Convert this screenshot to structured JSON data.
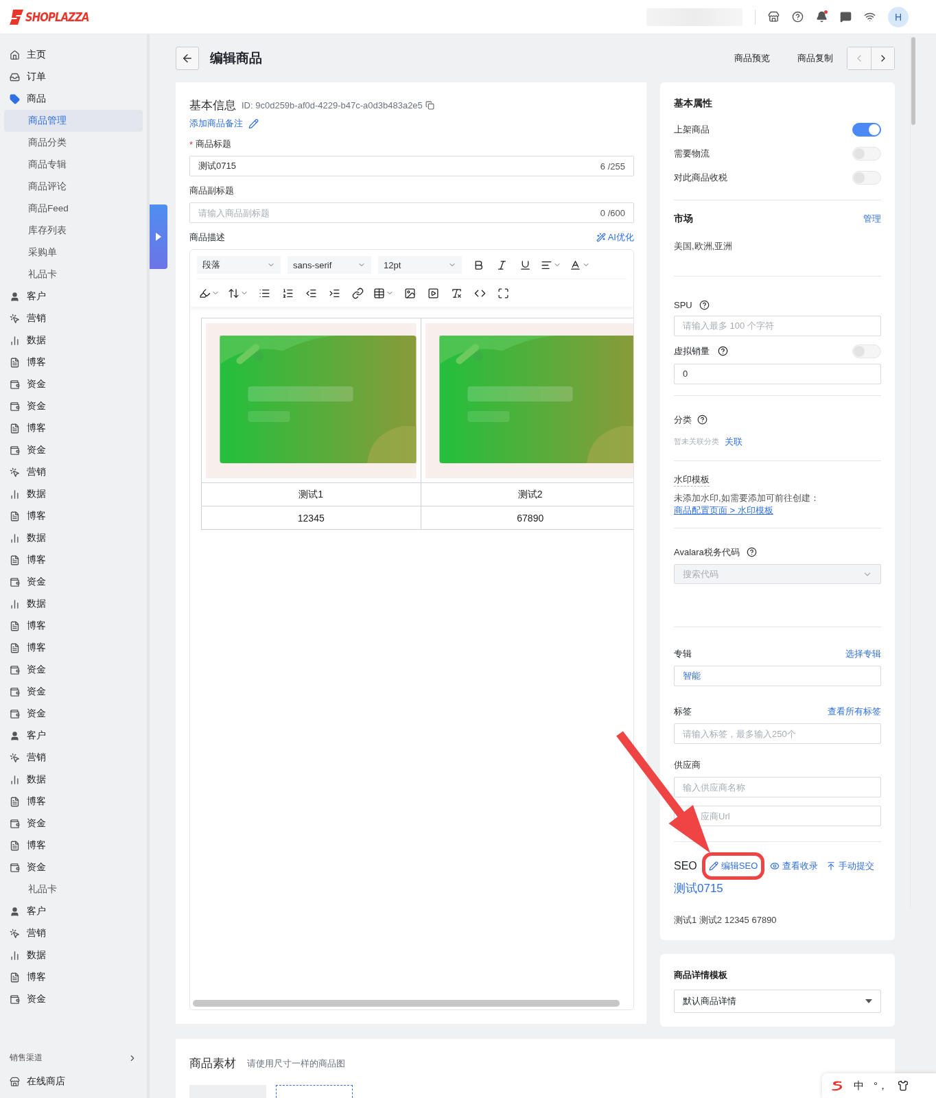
{
  "header": {
    "logo": "SHOPLAZZA",
    "avatar": "H",
    "notification_dot": true
  },
  "sidebar": {
    "items": [
      {
        "label": "主页",
        "kind": "home",
        "selected": false
      },
      {
        "label": "订单",
        "kind": "orders",
        "selected": false
      },
      {
        "label": "商品",
        "kind": "products",
        "selected": false
      },
      {
        "label": "商品管理",
        "kind": "sub",
        "selected": true
      },
      {
        "label": "商品分类",
        "kind": "sub",
        "selected": false
      },
      {
        "label": "商品专辑",
        "kind": "sub",
        "selected": false
      },
      {
        "label": "商品评论",
        "kind": "sub",
        "selected": false
      },
      {
        "label": "商品Feed",
        "kind": "sub",
        "selected": false
      },
      {
        "label": "库存列表",
        "kind": "sub",
        "selected": false
      },
      {
        "label": "采购单",
        "kind": "sub",
        "selected": false
      },
      {
        "label": "礼品卡",
        "kind": "sub",
        "selected": false
      },
      {
        "label": "客户",
        "kind": "customers",
        "selected": false
      },
      {
        "label": "营销",
        "kind": "marketing",
        "selected": false
      },
      {
        "label": "数据",
        "kind": "analytics",
        "selected": false
      },
      {
        "label": "博客",
        "kind": "blog",
        "selected": false
      },
      {
        "label": "资金",
        "kind": "finance",
        "selected": false
      },
      {
        "label": "资金",
        "kind": "finance",
        "selected": false
      },
      {
        "label": "博客",
        "kind": "blog",
        "selected": false
      },
      {
        "label": "资金",
        "kind": "finance",
        "selected": false
      },
      {
        "label": "营销",
        "kind": "marketing",
        "selected": false
      },
      {
        "label": "数据",
        "kind": "analytics",
        "selected": false
      },
      {
        "label": "博客",
        "kind": "blog",
        "selected": false
      },
      {
        "label": "数据",
        "kind": "analytics",
        "selected": false
      },
      {
        "label": "博客",
        "kind": "blog",
        "selected": false
      },
      {
        "label": "资金",
        "kind": "finance",
        "selected": false
      },
      {
        "label": "数据",
        "kind": "analytics",
        "selected": false
      },
      {
        "label": "博客",
        "kind": "blog",
        "selected": false
      },
      {
        "label": "博客",
        "kind": "blog",
        "selected": false
      },
      {
        "label": "资金",
        "kind": "finance",
        "selected": false
      },
      {
        "label": "资金",
        "kind": "finance",
        "selected": false
      },
      {
        "label": "资金",
        "kind": "finance",
        "selected": false
      },
      {
        "label": "客户",
        "kind": "customers",
        "selected": false
      },
      {
        "label": "营销",
        "kind": "marketing",
        "selected": false
      },
      {
        "label": "数据",
        "kind": "analytics",
        "selected": false
      },
      {
        "label": "博客",
        "kind": "blog",
        "selected": false
      },
      {
        "label": "资金",
        "kind": "finance",
        "selected": false
      },
      {
        "label": "博客",
        "kind": "blog",
        "selected": false
      },
      {
        "label": "资金",
        "kind": "finance",
        "selected": false
      },
      {
        "label": "礼品卡",
        "kind": "sub",
        "selected": false
      },
      {
        "label": "客户",
        "kind": "customers",
        "selected": false
      },
      {
        "label": "营销",
        "kind": "marketing",
        "selected": false
      },
      {
        "label": "数据",
        "kind": "analytics",
        "selected": false
      },
      {
        "label": "博客",
        "kind": "blog",
        "selected": false
      },
      {
        "label": "资金",
        "kind": "finance",
        "selected": false
      }
    ],
    "section": "销售渠道",
    "section_item": "在线商店"
  },
  "page": {
    "title": "编辑商品",
    "actions": [
      "商品预览",
      "商品复制"
    ]
  },
  "basic_info": {
    "title": "基本信息",
    "id": "ID: 9c0d259b-af0d-4229-b47c-a0d3b483a2e5",
    "note_link": "添加商品备注",
    "title_field": {
      "label": "商品标题",
      "required": true,
      "required_mark": "*",
      "value": "测试0715",
      "count": "6 /255"
    },
    "subtitle_field": {
      "label": "商品副标题",
      "placeholder": "请输入商品副标题",
      "count": "0 /600"
    },
    "description": {
      "label": "商品描述",
      "ai_action": "AI优化",
      "toolbar": {
        "block_format": "段落",
        "font": "sans-serif",
        "size": "12pt"
      },
      "table": {
        "images": [
          {
            "kind": "picture"
          },
          {
            "kind": "picture"
          }
        ],
        "rows": [
          [
            "测试1",
            "测试2"
          ],
          [
            "12345",
            "67890"
          ]
        ]
      }
    }
  },
  "attributes": {
    "title": "基本属性",
    "toggles": [
      {
        "label": "上架商品",
        "on": true
      },
      {
        "label": "需要物流",
        "on": false
      },
      {
        "label": "对此商品收税",
        "on": false
      }
    ],
    "market": {
      "title": "市场",
      "action": "管理",
      "value": "美国,欧洲,亚洲"
    },
    "spu": {
      "label": "SPU",
      "placeholder": "请输入最多 100 个字符"
    },
    "virtual_sales": {
      "label": "虚拟销量",
      "on": false,
      "value": "0"
    },
    "category": {
      "label": "分类",
      "empty": "暂未关联分类",
      "action": "关联"
    },
    "watermark": {
      "label": "水印模板",
      "text": "未添加水印,如需要添加可前往创建：",
      "link": "商品配置页面 > 水印模板"
    },
    "avalara": {
      "label": "Avalara税务代码",
      "placeholder": "搜索代码"
    },
    "collection": {
      "label": "专辑",
      "action": "选择专辑",
      "value": "智能"
    },
    "tags": {
      "label": "标签",
      "action": "查看所有标签",
      "placeholder": "请输入标签，最多输入250个"
    },
    "supplier": {
      "label": "供应商",
      "name_placeholder": "输入供应商名称",
      "url_placeholder": "应商Url"
    },
    "seo": {
      "label": "SEO",
      "actions": [
        {
          "label": "编辑SEO",
          "kind": "edit",
          "highlighted": true
        },
        {
          "label": "查看收录",
          "kind": "view",
          "highlighted": false
        },
        {
          "label": "手动提交",
          "kind": "submit",
          "highlighted": false
        }
      ],
      "title": "测试0715",
      "description": "测试1 测试2 12345 67890"
    }
  },
  "template": {
    "title": "商品详情模板",
    "value": "默认商品详情"
  },
  "media": {
    "title": "商品素材",
    "hint": "请使用尺寸一样的商品图"
  },
  "ime": {
    "mode": "中",
    "punctuation": "°，"
  }
}
